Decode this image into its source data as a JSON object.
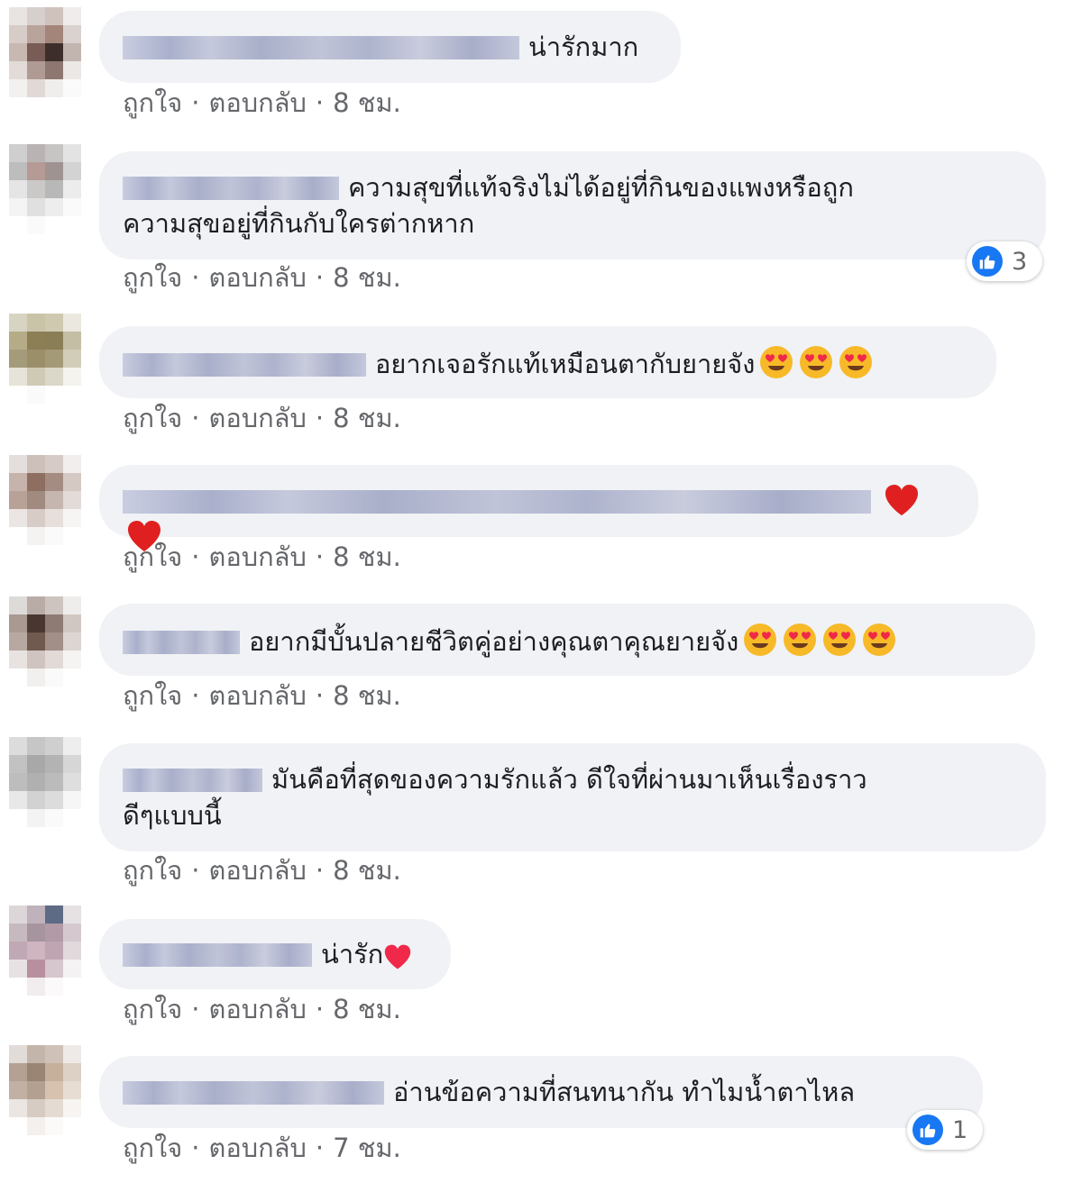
{
  "actions": {
    "like": "ถูกใจ",
    "reply": "ตอบกลับ",
    "separator": "·"
  },
  "comments": [
    {
      "text": "น่ารักมาก",
      "time": "8 ชม."
    },
    {
      "text": "ความสุขที่แท้จริงไม่ได้อยู่ที่กินของแพงหรือถูก\nความสุขอยู่ที่กินกับใครต่ากหาก",
      "time": "8 ชม.",
      "reactions": "3"
    },
    {
      "text": "อยากเจอรักแท้เหมือนตากับยายจัง",
      "time": "8 ชม.",
      "emoji": "heart-eyes-emoji x3"
    },
    {
      "text": "",
      "time": "8 ชม.",
      "emoji": "red-heart-emoji x2"
    },
    {
      "text": "อยากมีบั้นปลายชีวิตคู่อย่างคุณตาคุณยายจัง",
      "time": "8 ชม.",
      "emoji": "heart-eyes-emoji x4"
    },
    {
      "text": "มันคือที่สุดของความรักแล้ว ดีใจที่ผ่านมาเห็นเรื่องราว\nดีๆแบบนี้",
      "time": "8 ชม."
    },
    {
      "text": "น่ารัก",
      "time": "8 ชม.",
      "emoji": "heart-emoji"
    },
    {
      "text": "อ่านข้อความที่สนทนากัน ทำไมน้ำตาไหล",
      "time": "7 ชม.",
      "reactions": "1"
    }
  ],
  "colors": {
    "bubble": "#f0f2f5",
    "meta_text": "#65676b",
    "like_blue": "#1877f2",
    "emoji_yellow": "#f7b928",
    "heart_red": "#f02849"
  }
}
